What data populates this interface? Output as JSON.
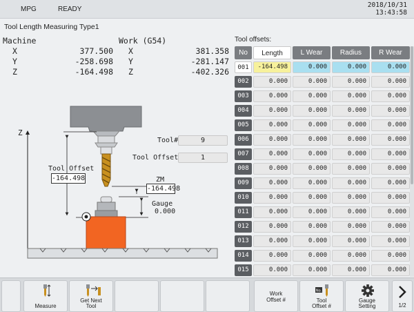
{
  "status": {
    "mode": "MPG",
    "state": "READY",
    "date": "2018/10/31",
    "time": "13:43:58"
  },
  "screen_title": "Tool Length Measuring Type1",
  "machine": {
    "title": "Machine",
    "rows": [
      {
        "axis": "X",
        "value": "377.500"
      },
      {
        "axis": "Y",
        "value": "-258.698"
      },
      {
        "axis": "Z",
        "value": "-164.498"
      }
    ]
  },
  "work": {
    "title": "Work (G54)",
    "rows": [
      {
        "axis": "X",
        "value": "381.358"
      },
      {
        "axis": "Y",
        "value": "-281.147"
      },
      {
        "axis": "Z",
        "value": "-402.326"
      }
    ]
  },
  "diagram": {
    "z_axis": "Z",
    "tool_label": "Tool#",
    "tool_value": "9",
    "tool_offset_label": "Tool Offset#",
    "tool_offset_value": "1",
    "tool_offset_caption": "Tool Offset",
    "tool_offset_len": "-164.498",
    "zm_label": "ZM",
    "zm_value": "-164.498",
    "gauge_label": "Gauge",
    "gauge_value": "0.000"
  },
  "offsets": {
    "title": "Tool offsets:",
    "headers": [
      "No",
      "Length",
      "L Wear",
      "Radius",
      "R Wear"
    ],
    "rows": [
      {
        "no": "001",
        "length": "-164.498",
        "lwear": "0.000",
        "radius": "0.000",
        "rwear": "0.000"
      },
      {
        "no": "002",
        "length": "0.000",
        "lwear": "0.000",
        "radius": "0.000",
        "rwear": "0.000"
      },
      {
        "no": "003",
        "length": "0.000",
        "lwear": "0.000",
        "radius": "0.000",
        "rwear": "0.000"
      },
      {
        "no": "004",
        "length": "0.000",
        "lwear": "0.000",
        "radius": "0.000",
        "rwear": "0.000"
      },
      {
        "no": "005",
        "length": "0.000",
        "lwear": "0.000",
        "radius": "0.000",
        "rwear": "0.000"
      },
      {
        "no": "006",
        "length": "0.000",
        "lwear": "0.000",
        "radius": "0.000",
        "rwear": "0.000"
      },
      {
        "no": "007",
        "length": "0.000",
        "lwear": "0.000",
        "radius": "0.000",
        "rwear": "0.000"
      },
      {
        "no": "008",
        "length": "0.000",
        "lwear": "0.000",
        "radius": "0.000",
        "rwear": "0.000"
      },
      {
        "no": "009",
        "length": "0.000",
        "lwear": "0.000",
        "radius": "0.000",
        "rwear": "0.000"
      },
      {
        "no": "010",
        "length": "0.000",
        "lwear": "0.000",
        "radius": "0.000",
        "rwear": "0.000"
      },
      {
        "no": "011",
        "length": "0.000",
        "lwear": "0.000",
        "radius": "0.000",
        "rwear": "0.000"
      },
      {
        "no": "012",
        "length": "0.000",
        "lwear": "0.000",
        "radius": "0.000",
        "rwear": "0.000"
      },
      {
        "no": "013",
        "length": "0.000",
        "lwear": "0.000",
        "radius": "0.000",
        "rwear": "0.000"
      },
      {
        "no": "014",
        "length": "0.000",
        "lwear": "0.000",
        "radius": "0.000",
        "rwear": "0.000"
      },
      {
        "no": "015",
        "length": "0.000",
        "lwear": "0.000",
        "radius": "0.000",
        "rwear": "0.000"
      }
    ]
  },
  "softkeys": {
    "measure": "Measure",
    "get_next_tool_1": "Get Next",
    "get_next_tool_2": "Tool",
    "work_offset_1": "Work",
    "work_offset_2": "Offset #",
    "tool_offset_1": "Tool",
    "tool_offset_2": "Offset #",
    "tool_offset_badge": "No.",
    "gauge_setting_1": "Gauge",
    "gauge_setting_2": "Setting",
    "page": "1/2"
  },
  "colors": {
    "gauge_block": "#f26522",
    "selected_length": "#f7f19c",
    "selected_cell": "#a9dff0",
    "row_number": "#5b5e62"
  }
}
